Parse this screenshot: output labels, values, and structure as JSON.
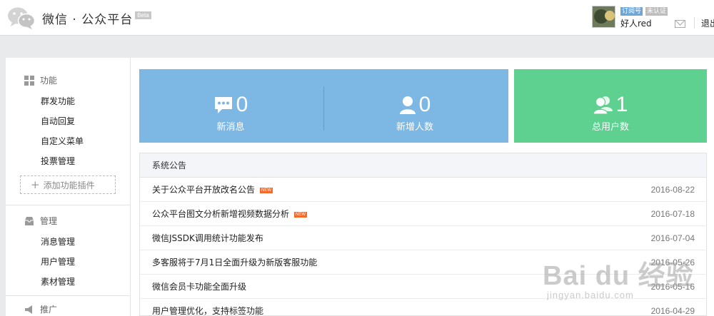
{
  "header": {
    "brand": "微信 · 公众平台",
    "beta": "Beta",
    "tag_subscription": "订阅号",
    "tag_unverified": "未认证",
    "username": "好人red",
    "logout": "退出"
  },
  "sidebar": {
    "function": {
      "title": "功能",
      "items": [
        "群发功能",
        "自动回复",
        "自定义菜单",
        "投票管理"
      ]
    },
    "add_plugin": "添加功能插件",
    "manage": {
      "title": "管理",
      "items": [
        "消息管理",
        "用户管理",
        "素材管理"
      ]
    },
    "promo": {
      "title": "推广"
    }
  },
  "stats": {
    "new_messages": {
      "value": "0",
      "label": "新消息"
    },
    "new_users": {
      "value": "0",
      "label": "新增人数"
    },
    "total_users": {
      "value": "1",
      "label": "总用户数"
    }
  },
  "notices": {
    "title": "系统公告",
    "new_badge": "NEW",
    "rows": [
      {
        "title": "关于公众平台开放改名公告",
        "date": "2016-08-22",
        "is_new": true
      },
      {
        "title": "公众平台图文分析新增视频数据分析",
        "date": "2016-07-18",
        "is_new": true
      },
      {
        "title": "微信JSSDK调用统计功能发布",
        "date": "2016-07-04",
        "is_new": false
      },
      {
        "title": "多客服将于7月1日全面升级为新版客服功能",
        "date": "2016-05-26",
        "is_new": false
      },
      {
        "title": "微信会员卡功能全面升级",
        "date": "2016-05-16",
        "is_new": false
      },
      {
        "title": "用户管理优化，支持标签功能",
        "date": "2016-04-29",
        "is_new": false
      }
    ]
  },
  "watermark": {
    "main": "Bai du 经验",
    "sub": "jingyan.baidu.com"
  },
  "colors": {
    "card_blue": "#7db7e3",
    "card_green": "#5ed08f",
    "new_badge": "#f56a2a"
  }
}
